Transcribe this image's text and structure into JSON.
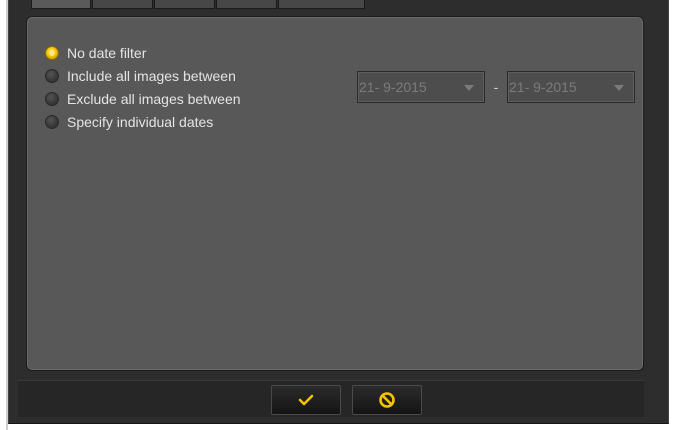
{
  "date_filter": {
    "options": [
      {
        "label": "No date filter",
        "checked": true
      },
      {
        "label": "Include all images between",
        "checked": false
      },
      {
        "label": "Exclude all images between",
        "checked": false
      },
      {
        "label": "Specify individual dates",
        "checked": false
      }
    ],
    "range": {
      "start": "21- 9-2015",
      "separator": "-",
      "end": "21- 9-2015",
      "enabled": false
    }
  },
  "buttons": {
    "ok_icon": "checkmark-icon",
    "cancel_icon": "cancel-icon"
  },
  "colors": {
    "accent": "#f5c400",
    "panel": "#585858",
    "window": "#2d2d2d"
  }
}
